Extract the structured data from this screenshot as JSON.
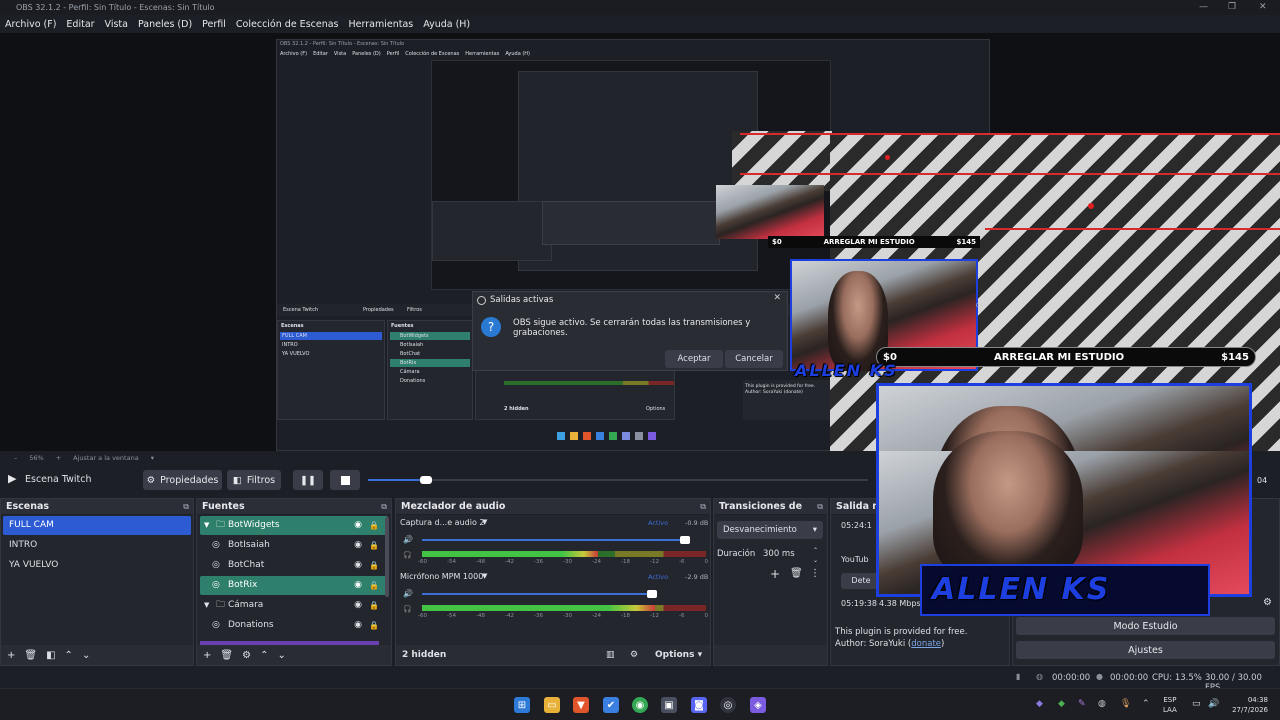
{
  "window": {
    "title": "OBS 32.1.2 - Perfil: Sin Título - Escenas: Sin Título"
  },
  "menu": [
    "Archivo (F)",
    "Editar",
    "Vista",
    "Paneles (D)",
    "Perfil",
    "Colección de Escenas",
    "Herramientas",
    "Ayuda (H)"
  ],
  "preview": {
    "nested_title": "OBS 32.1.2 - Perfil: Sin Título - Escenas: Sin Título",
    "nested_menu": [
      "Archivo (F)",
      "Editar",
      "Vista",
      "Paneles (D)",
      "Perfil",
      "Colección de Escenas",
      "Herramientas",
      "Ayuda (H)"
    ],
    "nested_scenes_title": "Escenas",
    "nested_sources_title": "Fuentes",
    "nested_scene_name": "Escena Twitch",
    "nested_props": "Propiedades",
    "nested_filters": "Filtros",
    "nested_scenes": [
      "FULL CAM",
      "INTRO",
      "YA VUELVO"
    ],
    "nested_sources": [
      "BotWidgets",
      "BotIsaiah",
      "BotChat",
      "BotRix",
      "Cámara",
      "Donations"
    ],
    "nested_hidden": "2 hidden",
    "nested_options": "Options",
    "nested_plugin": "This plugin is provided for free.",
    "nested_author": "Author: SoraYuki (donate)",
    "dialog": {
      "title": "Salidas activas",
      "message": "OBS sigue activo. Se cerrarán todas las transmisiones y grabaciones.",
      "accept": "Aceptar",
      "cancel": "Cancelar"
    },
    "goal_small": {
      "left": "$0",
      "label": "ARREGLAR MI ESTUDIO",
      "right": "$145"
    },
    "goal_large": {
      "left": "$0",
      "label": "ARREGLAR MI ESTUDIO",
      "right": "$145"
    },
    "brand": "ALLEN KS",
    "brand_big": "ALLEN KS",
    "side_time": "04"
  },
  "zoom": {
    "value": "56%",
    "fit": "Ajustar a la ventana"
  },
  "controls": {
    "scene_name": "Escena Twitch",
    "properties": "Propiedades",
    "filters": "Filtros",
    "timecode": "04"
  },
  "scenes": {
    "title": "Escenas",
    "items": [
      "FULL CAM",
      "INTRO",
      "YA VUELVO"
    ]
  },
  "sources": {
    "title": "Fuentes",
    "items": [
      {
        "name": "BotWidgets",
        "kind": "folder-icon",
        "group": true
      },
      {
        "name": "BotIsaiah",
        "kind": "browser-icon"
      },
      {
        "name": "BotChat",
        "kind": "browser-icon"
      },
      {
        "name": "BotRix",
        "kind": "browser-icon"
      },
      {
        "name": "Cámara",
        "kind": "folder-icon",
        "group": true
      },
      {
        "name": "Donations",
        "kind": "browser-icon"
      }
    ]
  },
  "mixer": {
    "title": "Mezclador de audio",
    "channels": [
      {
        "name": "Captura d...e audio 2",
        "status": "Activo",
        "db": "-0.9 dB",
        "level": 0.62,
        "volume": 0.94
      },
      {
        "name": "Micrófono MPM 1000",
        "status": "Activo",
        "db": "-2.9 dB",
        "level": 0.82,
        "volume": 0.82
      }
    ],
    "scale": [
      "-60",
      "-54",
      "-48",
      "-42",
      "-36",
      "-30",
      "-24",
      "-18",
      "-12",
      "-6",
      "0"
    ],
    "hidden": "2 hidden",
    "options": "Options"
  },
  "transitions": {
    "title": "Transiciones de es...",
    "type": "Desvanecimiento",
    "duration_label": "Duración",
    "duration_value": "300 ms"
  },
  "outputs": {
    "title": "Salida m",
    "time1": "05:24:1",
    "service": "YouTub",
    "stop": "Dete",
    "time2": "05:19:38",
    "rate": "4.38 Mbps",
    "plugin": "This plugin is provided for free.",
    "author_prefix": "Author: SoraYuki (",
    "author_link": "donate",
    "author_suffix": ")"
  },
  "controls_dock": {
    "studio": "Modo Estudio",
    "settings": "Ajustes"
  },
  "status": {
    "rec_time": "00:00:00",
    "stream_time": "00:00:00",
    "cpu": "CPU: 13.5%",
    "fps": "30.00 / 30.00 FPS"
  },
  "taskbar": {
    "lang1": "ESP",
    "lang2": "LAA",
    "time": "04:38",
    "date": "27/7/2026"
  },
  "colors": {
    "accent_blue": "#2d5bd4",
    "selected_source": "#2e7f6c",
    "active_label": "#3b6fd8"
  }
}
